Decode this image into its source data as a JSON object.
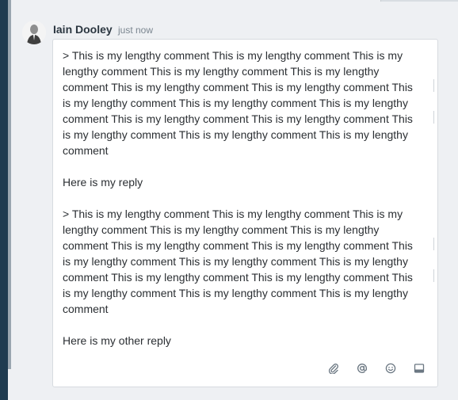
{
  "comment": {
    "author": "Iain Dooley",
    "timestamp": "just now",
    "paragraphs": [
      "> This is my lengthy comment This is my lengthy comment This is my lengthy comment This is my lengthy comment This is my lengthy comment This is my lengthy comment This is my lengthy comment This is my lengthy comment This is my lengthy comment This is my lengthy comment This is my lengthy comment This is my lengthy comment This is my lengthy comment This is my lengthy comment This is my lengthy comment",
      "Here is my reply",
      "> This is my lengthy comment This is my lengthy comment This is my lengthy comment This is my lengthy comment This is my lengthy comment This is my lengthy comment This is my lengthy comment This is my lengthy comment This is my lengthy comment This is my lengthy comment This is my lengthy comment This is my lengthy comment This is my lengthy comment This is my lengthy comment This is my lengthy comment",
      "Here is my other reply"
    ]
  },
  "toolbar": {
    "icons": [
      "paperclip-icon",
      "at-sign-icon",
      "smiley-icon",
      "panel-icon"
    ]
  },
  "colors": {
    "background": "#1f3b50",
    "panel": "#eef0f3",
    "author": "#2b3640",
    "icon": "#6b7782"
  }
}
